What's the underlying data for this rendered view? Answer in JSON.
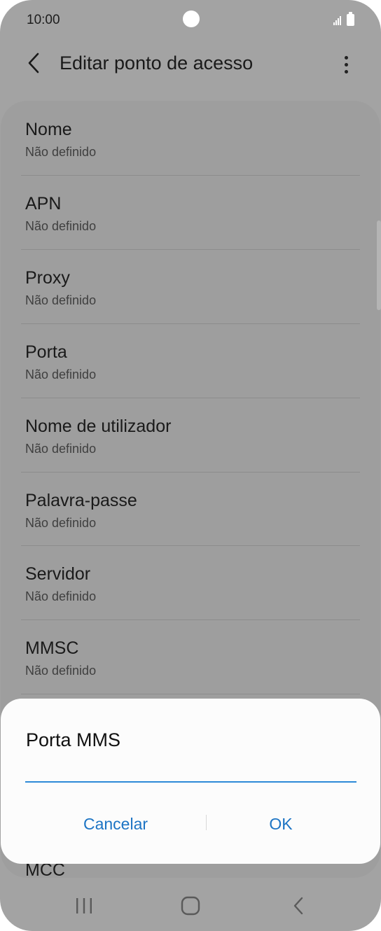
{
  "status_bar": {
    "time": "10:00",
    "icons": [
      "signal-icon",
      "battery-icon"
    ]
  },
  "header": {
    "title": "Editar ponto de acesso",
    "back_icon": "chevron-left-icon",
    "more_icon": "more-vertical-icon"
  },
  "list": {
    "items": [
      {
        "label": "Nome",
        "value": "Não definido"
      },
      {
        "label": "APN",
        "value": "Não definido"
      },
      {
        "label": "Proxy",
        "value": "Não definido"
      },
      {
        "label": "Porta",
        "value": "Não definido"
      },
      {
        "label": "Nome de utilizador",
        "value": "Não definido"
      },
      {
        "label": "Palavra-passe",
        "value": "Não definido"
      },
      {
        "label": "Servidor",
        "value": "Não definido"
      },
      {
        "label": "MMSC",
        "value": "Não definido"
      },
      {
        "label": "MCC"
      }
    ]
  },
  "dialog": {
    "title": "Porta MMS",
    "input_value": "",
    "cancel_label": "Cancelar",
    "ok_label": "OK"
  },
  "nav_bar": {
    "icons": [
      "recents-icon",
      "home-icon",
      "back-icon"
    ]
  },
  "colors": {
    "accent": "#1c74c4",
    "input_underline": "#2d8ad8",
    "scrim": "#a3a3a3",
    "dialog_bg": "#fcfcfc"
  }
}
